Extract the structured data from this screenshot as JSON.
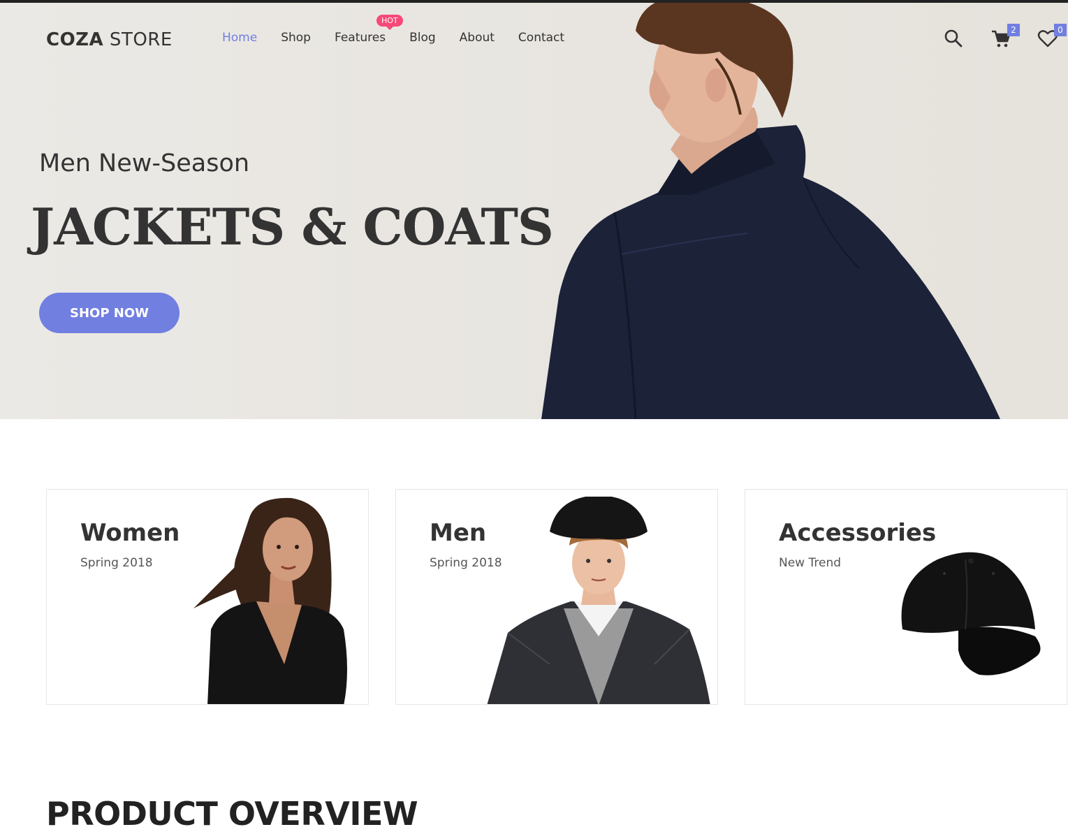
{
  "header": {
    "logo_bold": "COZA",
    "logo_light": " STORE",
    "nav": [
      {
        "label": "Home",
        "active": true
      },
      {
        "label": "Shop"
      },
      {
        "label": "Features",
        "badge": "HOT"
      },
      {
        "label": "Blog"
      },
      {
        "label": "About"
      },
      {
        "label": "Contact"
      }
    ],
    "cart_count": "2",
    "wishlist_count": "0",
    "icons": [
      "search-icon",
      "cart-icon",
      "heart-icon"
    ]
  },
  "hero": {
    "subtitle": "Men New-Season",
    "title": "JACKETS & COATS",
    "button_label": "SHOP NOW"
  },
  "categories": [
    {
      "title": "Women",
      "subtitle": "Spring 2018"
    },
    {
      "title": "Men",
      "subtitle": "Spring 2018"
    },
    {
      "title": "Accessories",
      "subtitle": "New Trend"
    }
  ],
  "section": {
    "title": "PRODUCT OVERVIEW"
  },
  "colors": {
    "accent": "#717fe0",
    "hot": "#f74877",
    "text": "#333333"
  }
}
